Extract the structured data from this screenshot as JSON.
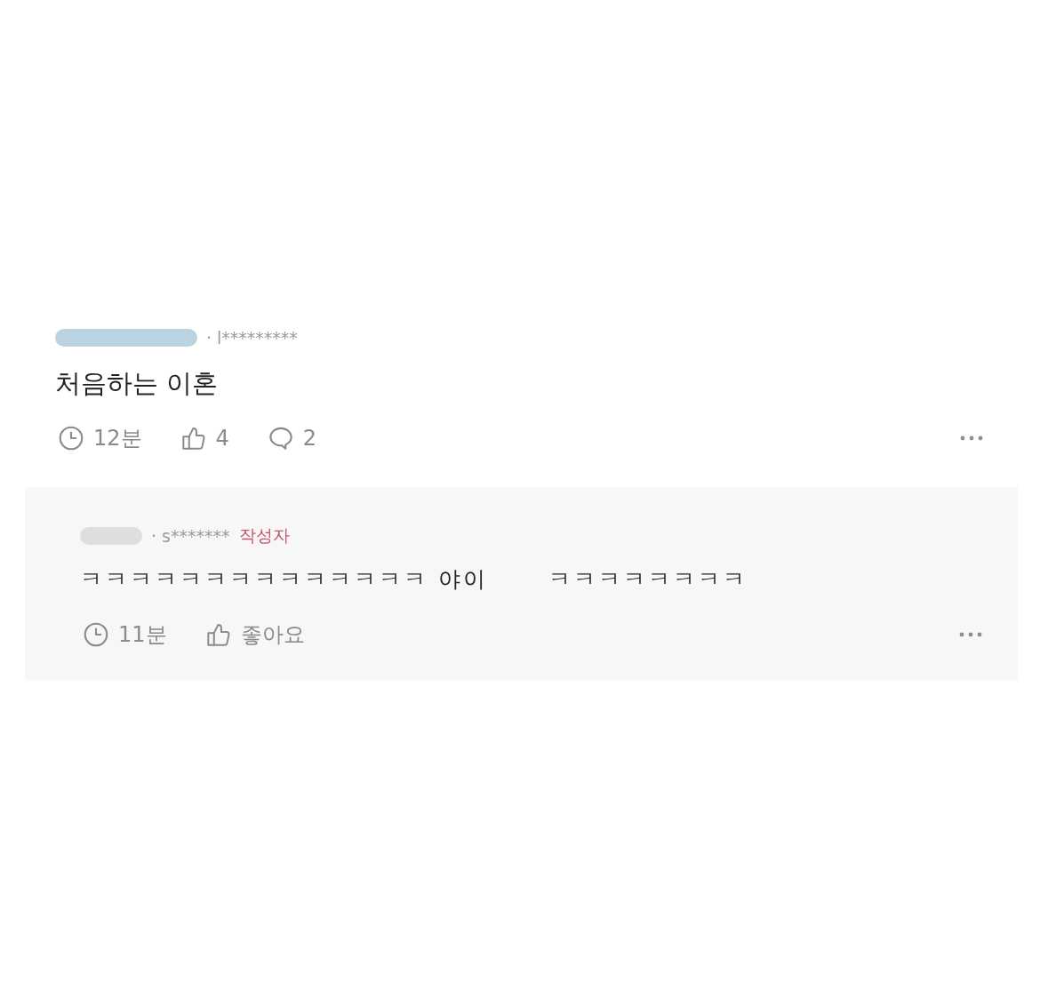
{
  "comments": [
    {
      "kind": "comment",
      "author": {
        "color": "#b9d4e0",
        "id_text": "· l*********"
      },
      "text": [
        "처음하는 이혼"
      ],
      "time": "12분",
      "like_label": "4",
      "reply_count": "2"
    },
    {
      "kind": "reply",
      "author": {
        "color": "#dedede",
        "id_text": "· s*******",
        "writer_badge": "작성자"
      },
      "text": [
        "ㅋㅋㅋㅋㅋㅋㅋㅋㅋㅋㅋㅋㅋㅋ 야이",
        "ㅋㅋㅋㅋㅋㅋㅋㅋ"
      ],
      "time": "11분",
      "like_label": "좋아요"
    }
  ]
}
